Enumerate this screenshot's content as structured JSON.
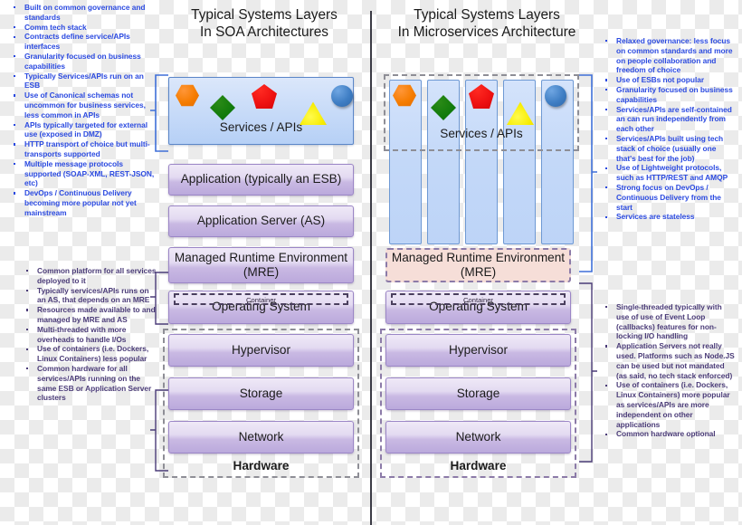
{
  "colors": {
    "note_blue": "#2b4ae0",
    "note_violet": "#4b3c78",
    "services_box": "#c6daf8",
    "layer_box": "#c9b9e3",
    "mre_microservices": "#f6ded8",
    "shape_orange": "#f57c00",
    "shape_green": "#117a0b",
    "shape_red": "#ee1111",
    "shape_yellow": "#f7ec00",
    "shape_blue": "#3f7ec4",
    "divider": "#3c3c46"
  },
  "left_panel": {
    "title_line1": "Typical Systems Layers",
    "title_line2": "In SOA Architectures",
    "services_label": "Services / APIs",
    "shapes": [
      "orange-hexagon",
      "green-diamond",
      "red-pentagon",
      "yellow-triangle",
      "blue-circle"
    ],
    "layers": [
      "Application (typically an ESB)",
      "Application Server (AS)",
      "Managed Runtime Environment (MRE)",
      "Operating System",
      "Hypervisor",
      "Storage",
      "Network"
    ],
    "container_label": "Container",
    "hardware_label": "Hardware"
  },
  "right_panel": {
    "title_line1": "Typical Systems Layers",
    "title_line2": "In Microservices Architecture",
    "services_label": "Services / APIs",
    "shapes": [
      "orange-hexagon",
      "green-diamond",
      "red-pentagon",
      "yellow-triangle",
      "blue-circle"
    ],
    "column_count": 5,
    "layers": [
      "Managed Runtime Environment (MRE)",
      "Operating System",
      "Hypervisor",
      "Storage",
      "Network"
    ],
    "container_label": "Container",
    "hardware_label": "Hardware"
  },
  "notes_top_left": [
    "Built on common governance and standards",
    "Comm tech stack",
    "Contracts define service/APIs interfaces",
    "Granularity focused on business capabilities",
    "Typically Services/APIs run on an ESB",
    "Use of Canonical schemas not uncommon for business services, less common in APIs",
    "APIs typically targeted for external use (exposed in DMZ)",
    "HTTP transport of choice but multi-transports supported",
    "Multiple message protocols supported (SOAP-XML, REST-JSON, etc)",
    "DevOps / Continuous Delivery becoming more popular not yet mainstream"
  ],
  "notes_bottom_left": [
    "Common platform for all services deployed to it",
    "Typically services/APIs runs on an AS, that depends on an MRE",
    "Resources made available to and managed by MRE and AS",
    "Multi-threaded with more overheads to handle I/Os",
    "Use of containers (i.e. Dockers, Linux Containers) less popular",
    "Common hardware for all services/APIs running on the same ESB or Application Server clusters"
  ],
  "notes_top_right": [
    "Relaxed governance: less focus on common standards and more on people collaboration and freedom of choice",
    "Use of ESBs not popular",
    "Granularity focused on business capabilities",
    "Services/APIs are self-contained an can run independently from each other",
    "Services/APIs built using tech stack of choice (usually one that's best for the job)",
    "Use of Lightweight protocols, such as HTTP/REST and AMQP",
    "Strong focus on DevOps / Continuous Delivery from the start",
    "Services are stateless"
  ],
  "notes_bottom_right": [
    "Single-threaded typically with use of use of Event Loop (callbacks) features for non-locking I/O handling",
    "Application Servers not really used. Platforms such as Node.JS can be used but not mandated (as said, no tech stack enforced)",
    "Use of containers (i.e. Dockers, Linux Containers) more popular as services/APIs are more independent on other applications",
    "Common hardware optional"
  ]
}
